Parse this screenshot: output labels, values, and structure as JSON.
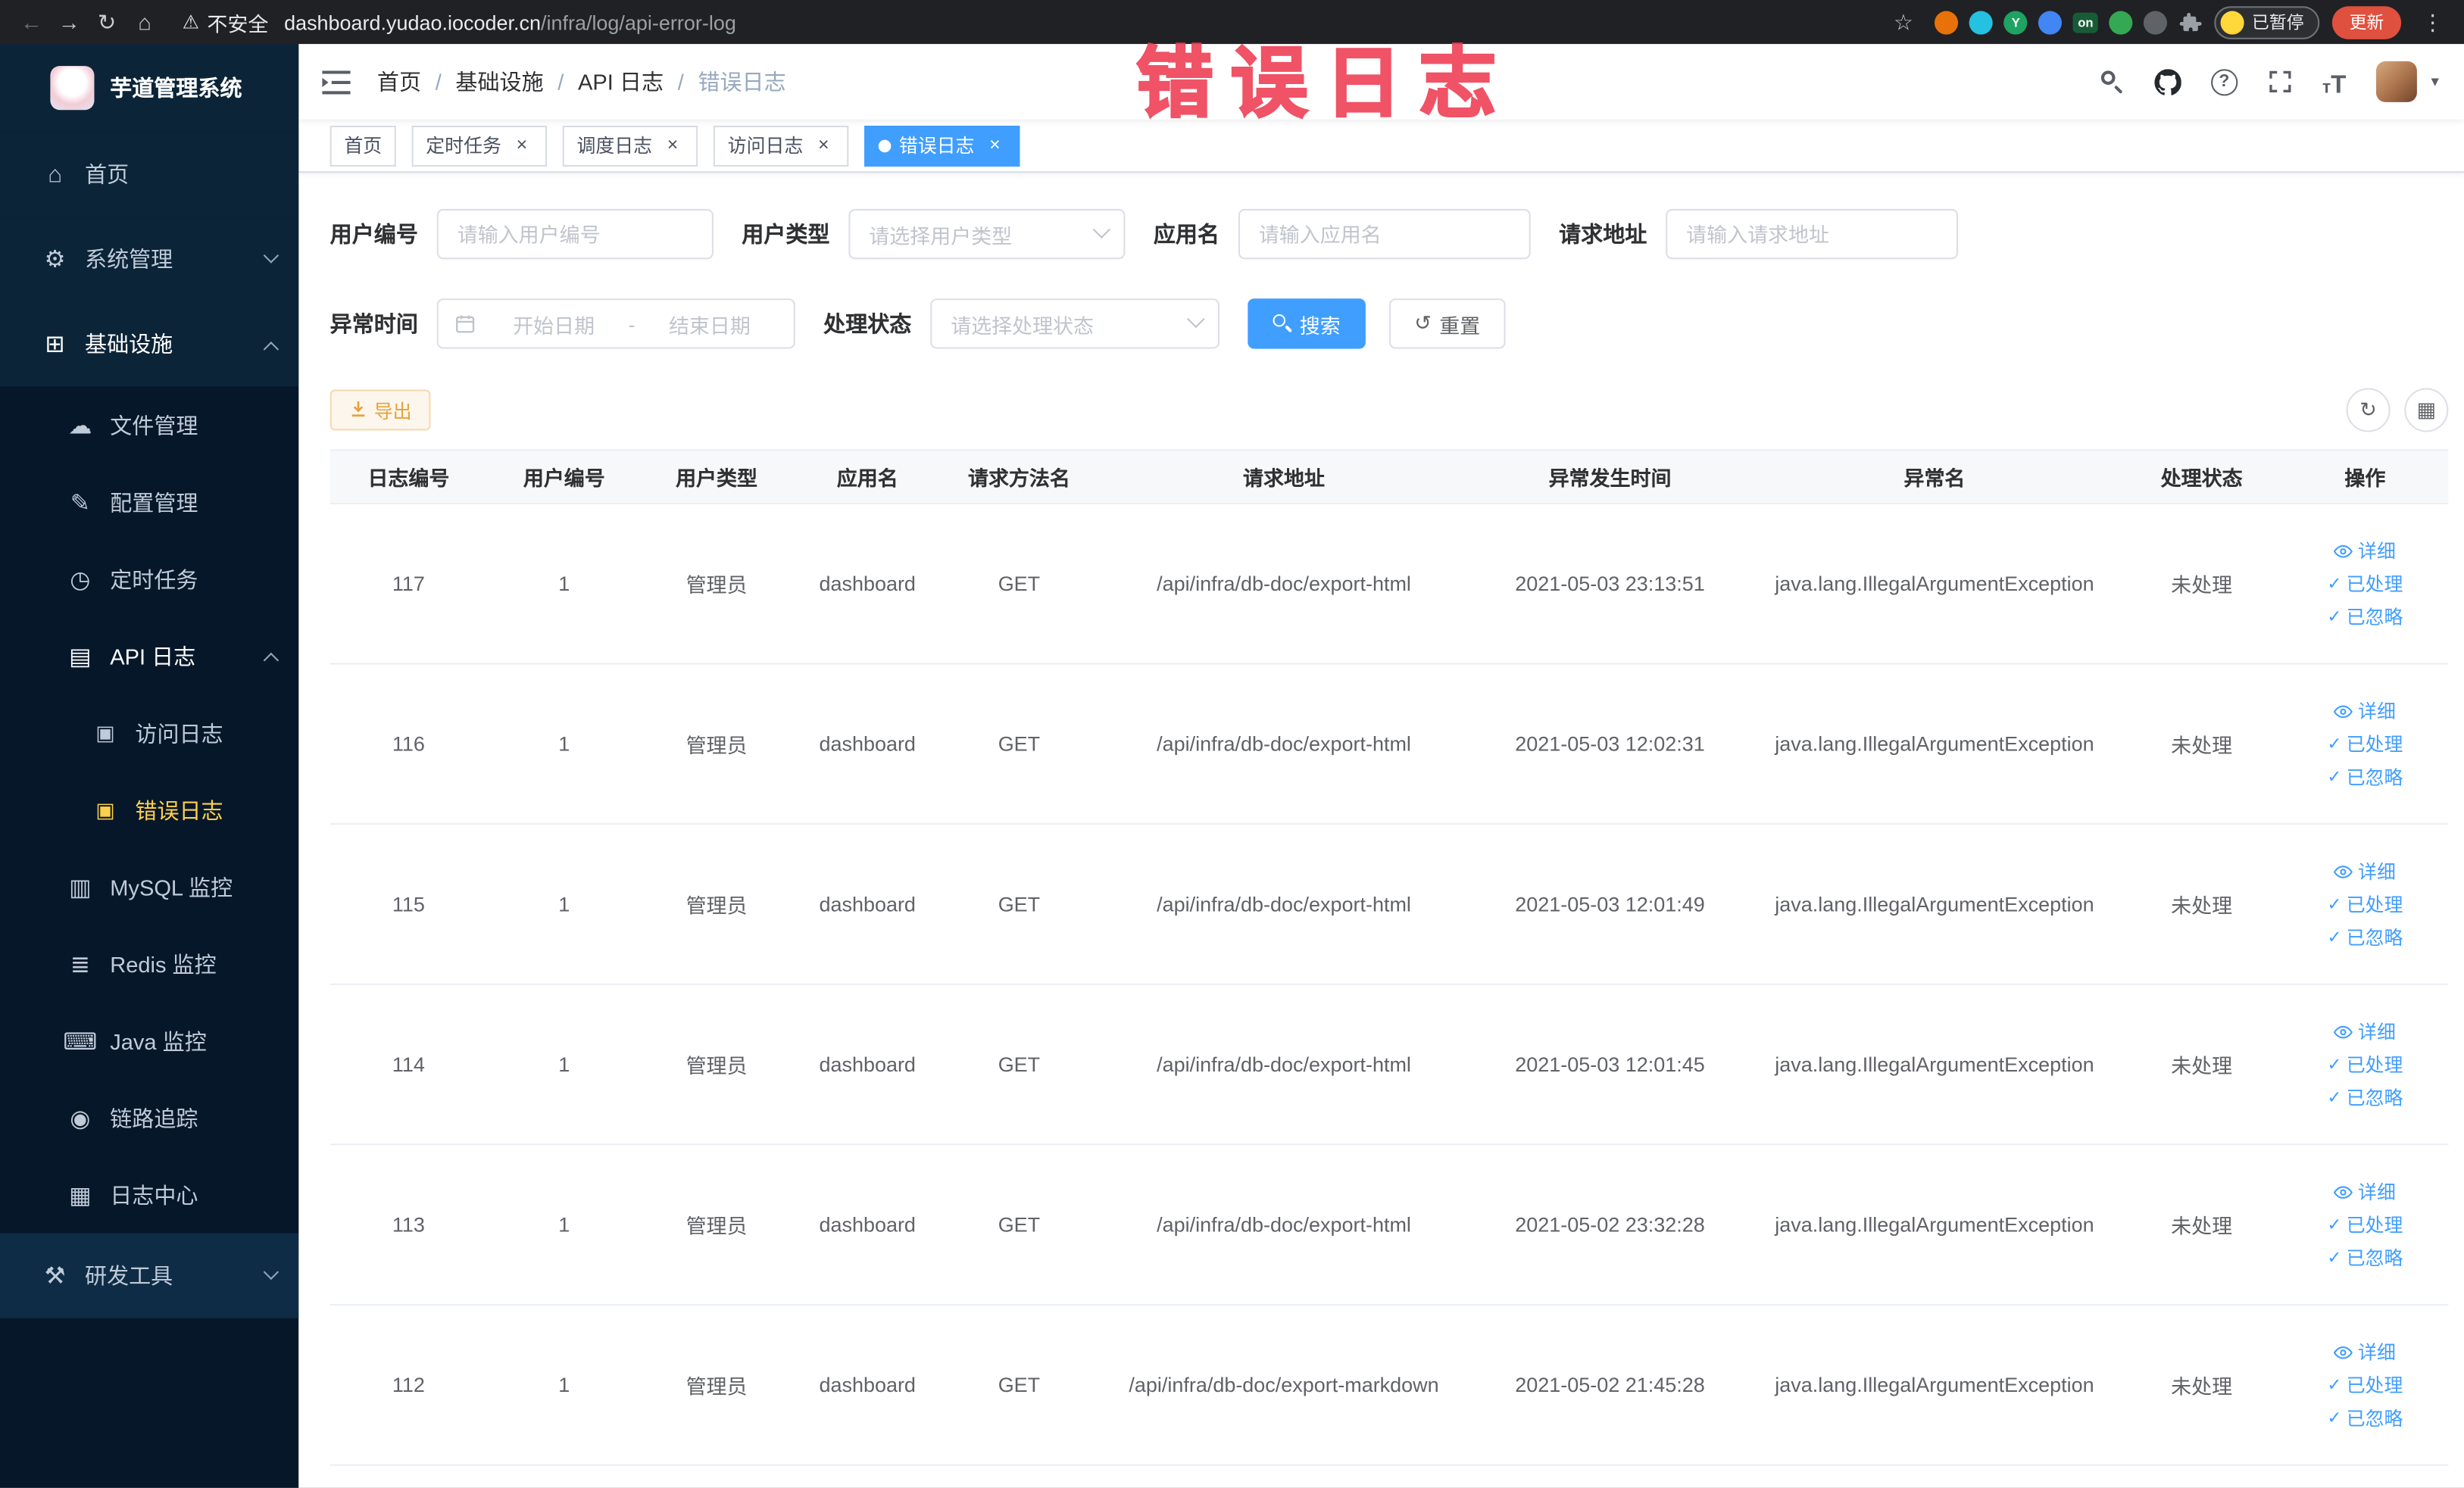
{
  "colors": {
    "primary": "#409eff",
    "warning": "#e6a23c",
    "annotation_red": "#ee3b52",
    "sidebar_bg": "#0c2438",
    "sidebar_sub_bg": "#07172a",
    "active_menu_text": "#ffd04b",
    "chrome_bg": "#202124",
    "active_tab_bg": "#409eff",
    "update_button_bg": "#e0503e"
  },
  "icons": {
    "back": "←",
    "forward": "→",
    "reload": "↻",
    "home": "⌂",
    "warning": "⚠",
    "star": "☆",
    "overflow": "⋮",
    "caret-down": "▾",
    "reset": "↺",
    "refresh": "↻",
    "columns": "▦",
    "check": "✓",
    "menu-home": "⌂",
    "menu-system": "⚙",
    "menu-infra": "⊞",
    "menu-file": "☁",
    "menu-config": "✎",
    "menu-job": "◷",
    "menu-api-log": "▤",
    "menu-access-log": "▣",
    "menu-error-log": "▣",
    "menu-mysql": "▥",
    "menu-redis": "≣",
    "menu-java": "⌨",
    "menu-trace": "◉",
    "menu-log-center": "▦",
    "menu-dev": "⚒"
  },
  "browser": {
    "security_label": "不安全",
    "url_host": "dashboard.yudao.iocoder.cn",
    "url_path": "/infra/log/api-error-log",
    "extensions": [
      {
        "name": "extension-orange",
        "color": "#e8710a",
        "glyph": ""
      },
      {
        "name": "extension-teal-drop",
        "color": "#24c1e0",
        "glyph": ""
      },
      {
        "name": "extension-green-y",
        "color": "#1ea362",
        "glyph": "Y"
      },
      {
        "name": "extension-blue-grid",
        "color": "#4285f4",
        "glyph": ""
      },
      {
        "name": "extension-on-badge",
        "color": "#185c37",
        "glyph": "on"
      },
      {
        "name": "extension-leaf",
        "color": "#34a853",
        "glyph": ""
      },
      {
        "name": "extension-paw",
        "color": "#5f6368",
        "glyph": ""
      }
    ],
    "paused_badge": "已暂停",
    "update_button": "更新"
  },
  "annotation": {
    "text": "错误日志"
  },
  "sidebar": {
    "logo_title": "芋道管理系统",
    "menu": [
      {
        "key": "home",
        "label": "首页",
        "icon": "menu-home",
        "level": 1
      },
      {
        "key": "system",
        "label": "系统管理",
        "icon": "menu-system",
        "level": 1,
        "arrow": "down"
      },
      {
        "key": "infra",
        "label": "基础设施",
        "icon": "menu-infra",
        "level": 1,
        "arrow": "up",
        "open": true
      },
      {
        "key": "file",
        "label": "文件管理",
        "icon": "menu-file",
        "level": 2
      },
      {
        "key": "config",
        "label": "配置管理",
        "icon": "menu-config",
        "level": 2
      },
      {
        "key": "job",
        "label": "定时任务",
        "icon": "menu-job",
        "level": 2
      },
      {
        "key": "api-log",
        "label": "API 日志",
        "icon": "menu-api-log",
        "level": 2,
        "arrow": "up",
        "open": true
      },
      {
        "key": "access-log",
        "label": "访问日志",
        "icon": "menu-access-log",
        "level": 3
      },
      {
        "key": "error-log",
        "label": "错误日志",
        "icon": "menu-error-log",
        "level": 3,
        "active": true
      },
      {
        "key": "mysql",
        "label": "MySQL 监控",
        "icon": "menu-mysql",
        "level": 2
      },
      {
        "key": "redis",
        "label": "Redis 监控",
        "icon": "menu-redis",
        "level": 2
      },
      {
        "key": "java",
        "label": "Java 监控",
        "icon": "menu-java",
        "level": 2
      },
      {
        "key": "trace",
        "label": "链路追踪",
        "icon": "menu-trace",
        "level": 2
      },
      {
        "key": "log-center",
        "label": "日志中心",
        "icon": "menu-log-center",
        "level": 2
      },
      {
        "key": "dev-tools",
        "label": "研发工具",
        "icon": "menu-dev",
        "level": 1,
        "arrow": "down",
        "highlighted": true
      }
    ]
  },
  "header": {
    "breadcrumb": [
      "首页",
      "基础设施",
      "API 日志",
      "错误日志"
    ]
  },
  "tabs": [
    {
      "key": "home",
      "label": "首页",
      "closable": false,
      "active": false
    },
    {
      "key": "job",
      "label": "定时任务",
      "closable": true,
      "active": false
    },
    {
      "key": "job-log",
      "label": "调度日志",
      "closable": true,
      "active": false
    },
    {
      "key": "access-log",
      "label": "访问日志",
      "closable": true,
      "active": false
    },
    {
      "key": "error-log",
      "label": "错误日志",
      "closable": true,
      "active": true
    }
  ],
  "filters": {
    "user_id": {
      "label": "用户编号",
      "placeholder": "请输入用户编号"
    },
    "user_type": {
      "label": "用户类型",
      "placeholder": "请选择用户类型"
    },
    "app_name": {
      "label": "应用名",
      "placeholder": "请输入应用名"
    },
    "request_url": {
      "label": "请求地址",
      "placeholder": "请输入请求地址"
    },
    "exception_time": {
      "label": "异常时间",
      "start_placeholder": "开始日期",
      "separator": "-",
      "end_placeholder": "结束日期"
    },
    "process_status": {
      "label": "处理状态",
      "placeholder": "请选择处理状态"
    },
    "search_button": "搜索",
    "reset_button": "重置"
  },
  "toolbar": {
    "export_button": "导出"
  },
  "table": {
    "columns": [
      "日志编号",
      "用户编号",
      "用户类型",
      "应用名",
      "请求方法名",
      "请求地址",
      "异常发生时间",
      "异常名",
      "处理状态",
      "操作"
    ],
    "row_actions": [
      {
        "key": "detail",
        "label": "详细",
        "icon": "eye"
      },
      {
        "key": "processed",
        "label": "已处理",
        "icon": "check"
      },
      {
        "key": "ignored",
        "label": "已忽略",
        "icon": "check"
      }
    ],
    "rows": [
      {
        "log_id": "117",
        "user_id": "1",
        "user_type": "管理员",
        "app_name": "dashboard",
        "method": "GET",
        "url": "/api/infra/db-doc/export-html",
        "time": "2021-05-03 23:13:51",
        "exception": "java.lang.IllegalArgumentException",
        "status": "未处理"
      },
      {
        "log_id": "116",
        "user_id": "1",
        "user_type": "管理员",
        "app_name": "dashboard",
        "method": "GET",
        "url": "/api/infra/db-doc/export-html",
        "time": "2021-05-03 12:02:31",
        "exception": "java.lang.IllegalArgumentException",
        "status": "未处理"
      },
      {
        "log_id": "115",
        "user_id": "1",
        "user_type": "管理员",
        "app_name": "dashboard",
        "method": "GET",
        "url": "/api/infra/db-doc/export-html",
        "time": "2021-05-03 12:01:49",
        "exception": "java.lang.IllegalArgumentException",
        "status": "未处理"
      },
      {
        "log_id": "114",
        "user_id": "1",
        "user_type": "管理员",
        "app_name": "dashboard",
        "method": "GET",
        "url": "/api/infra/db-doc/export-html",
        "time": "2021-05-03 12:01:45",
        "exception": "java.lang.IllegalArgumentException",
        "status": "未处理"
      },
      {
        "log_id": "113",
        "user_id": "1",
        "user_type": "管理员",
        "app_name": "dashboard",
        "method": "GET",
        "url": "/api/infra/db-doc/export-html",
        "time": "2021-05-02 23:32:28",
        "exception": "java.lang.IllegalArgumentException",
        "status": "未处理"
      },
      {
        "log_id": "112",
        "user_id": "1",
        "user_type": "管理员",
        "app_name": "dashboard",
        "method": "GET",
        "url": "/api/infra/db-doc/export-markdown",
        "time": "2021-05-02 21:45:28",
        "exception": "java.lang.IllegalArgumentException",
        "status": "未处理"
      }
    ]
  }
}
